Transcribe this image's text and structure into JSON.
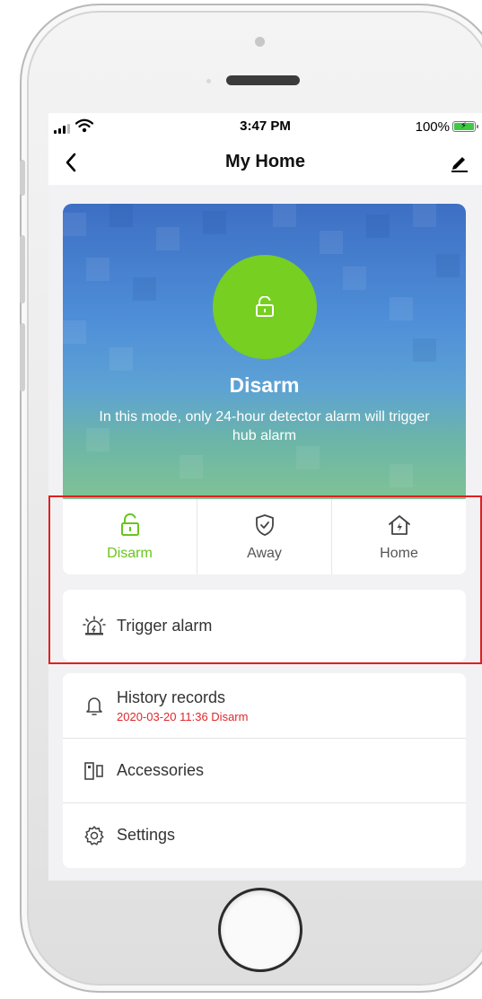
{
  "status_bar": {
    "time": "3:47 PM",
    "battery": "100%",
    "icons": [
      "signal-icon",
      "wifi-icon",
      "battery-charging-icon"
    ]
  },
  "nav": {
    "title": "My Home",
    "back_icon": "chevron-left-icon",
    "edit_icon": "pencil-icon"
  },
  "hero": {
    "icon": "unlocked-lock-icon",
    "mode_title": "Disarm",
    "description": "In this mode, only 24-hour detector alarm will trigger hub alarm",
    "accent_color": "#76cf21"
  },
  "modes": [
    {
      "label": "Disarm",
      "icon": "unlocked-lock-icon",
      "active": true
    },
    {
      "label": "Away",
      "icon": "shield-check-icon",
      "active": false
    },
    {
      "label": "Home",
      "icon": "house-bolt-icon",
      "active": false
    }
  ],
  "trigger": {
    "label": "Trigger alarm",
    "icon": "siren-icon"
  },
  "menu": {
    "history": {
      "label": "History records",
      "sub": "2020-03-20 11:36 Disarm",
      "icon": "bell-icon"
    },
    "accessories": {
      "label": "Accessories",
      "icon": "accessories-sensor-icon"
    },
    "settings": {
      "label": "Settings",
      "icon": "gear-icon"
    }
  },
  "colors": {
    "active_mode": "#68c51d",
    "history_sub": "#e0262b",
    "highlight_border": "#e02020"
  }
}
